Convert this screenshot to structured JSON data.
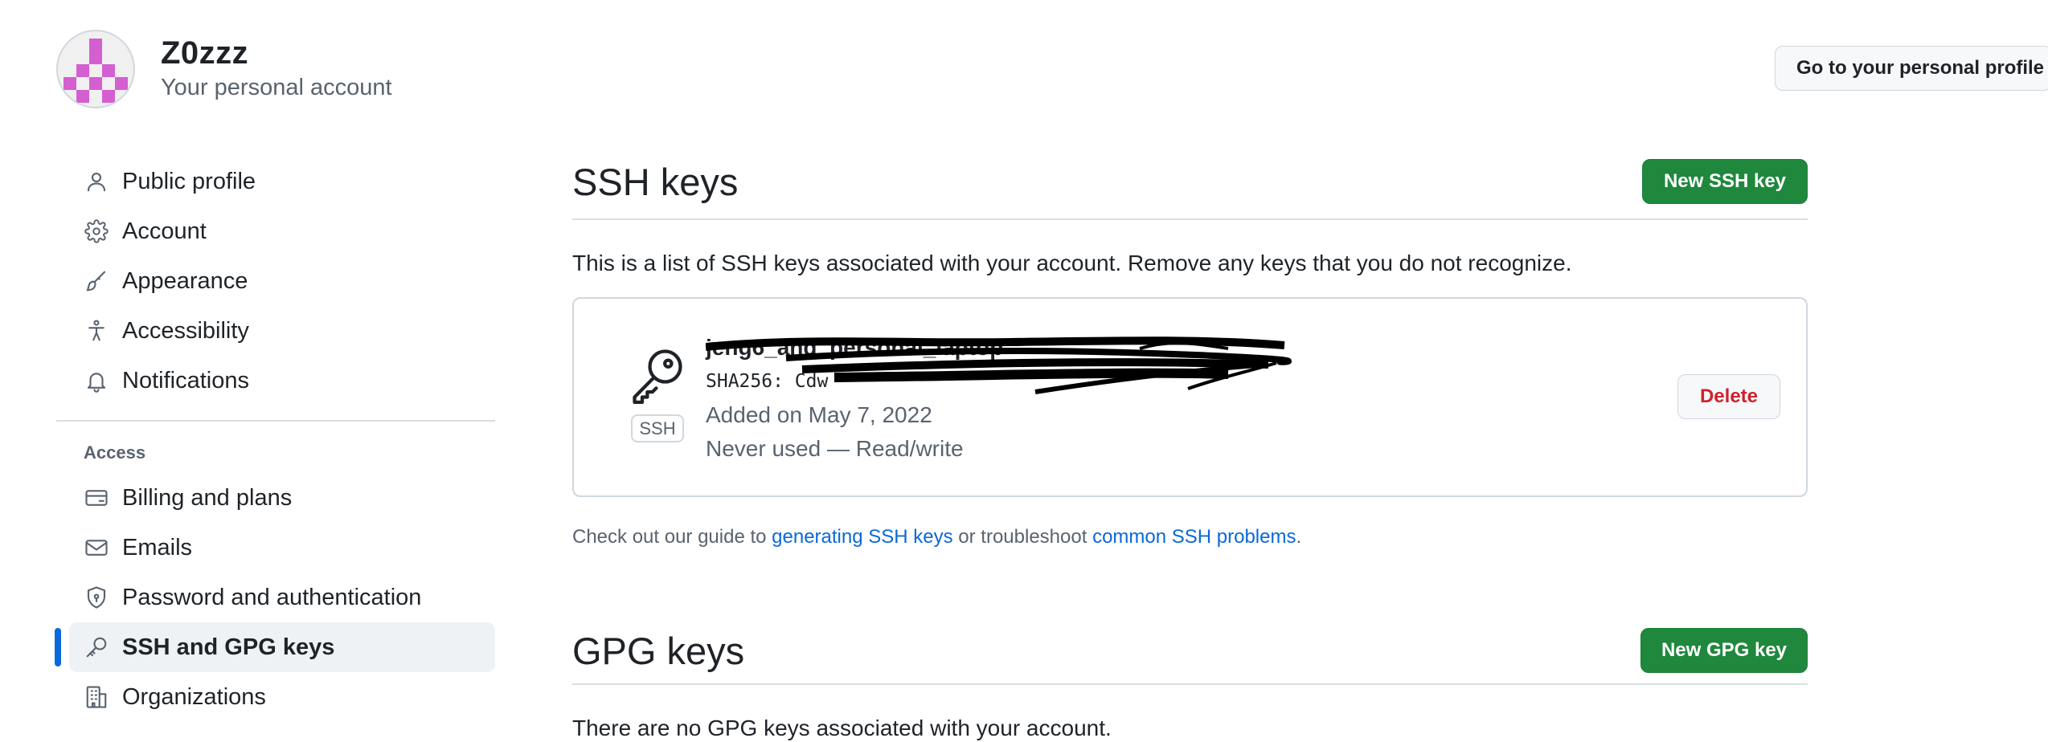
{
  "header": {
    "account_name": "Z0zzz",
    "account_subtitle": "Your personal account",
    "profile_button_label": "Go to your personal profile"
  },
  "sidebar": {
    "items": [
      {
        "label": "Public profile",
        "icon": "person-icon"
      },
      {
        "label": "Account",
        "icon": "gear-icon"
      },
      {
        "label": "Appearance",
        "icon": "paintbrush-icon"
      },
      {
        "label": "Accessibility",
        "icon": "accessibility-icon"
      },
      {
        "label": "Notifications",
        "icon": "bell-icon"
      }
    ],
    "access_heading": "Access",
    "access_items": [
      {
        "label": "Billing and plans",
        "icon": "credit-card-icon"
      },
      {
        "label": "Emails",
        "icon": "mail-icon"
      },
      {
        "label": "Password and authentication",
        "icon": "shield-lock-icon"
      },
      {
        "label": "SSH and GPG keys",
        "icon": "key-icon",
        "active": true
      },
      {
        "label": "Organizations",
        "icon": "organization-icon"
      }
    ]
  },
  "ssh_section": {
    "title": "SSH keys",
    "new_button_label": "New SSH key",
    "description": "This is a list of SSH keys associated with your account. Remove any keys that you do not recognize.",
    "key": {
      "title": "jeng6_and_personal_laptop",
      "fingerprint": "SHA256:                                    Cdw",
      "badge": "SSH",
      "added": "Added on May 7, 2022",
      "usage": "Never used — Read/write",
      "delete_label": "Delete"
    },
    "guide": {
      "prefix": "Check out our guide to ",
      "link1": "generating SSH keys",
      "middle": " or troubleshoot ",
      "link2": "common SSH problems",
      "suffix": "."
    }
  },
  "gpg_section": {
    "title": "GPG keys",
    "new_button_label": "New GPG key",
    "empty_text": "There are no GPG keys associated with your account."
  },
  "colors": {
    "primary_green": "#1f883d",
    "link_blue": "#0969da",
    "danger_red": "#cf222e",
    "active_indicator": "#0969da",
    "avatar_accent": "#d45fd1"
  }
}
